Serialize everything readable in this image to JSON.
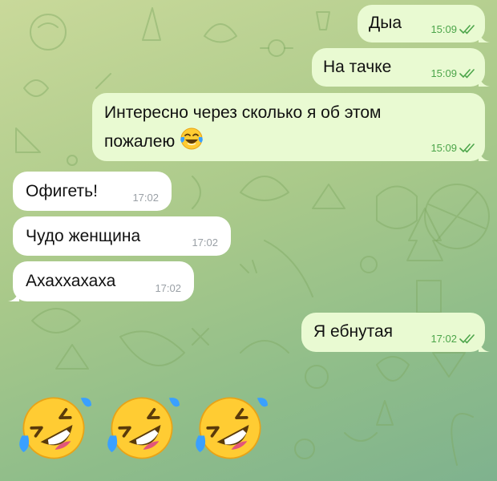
{
  "messages": [
    {
      "dir": "out",
      "text": "Дыа",
      "time": "15:09",
      "status": "read"
    },
    {
      "dir": "out",
      "text": "На тачке",
      "time": "15:09",
      "status": "read"
    },
    {
      "dir": "out",
      "text": "Интересно через сколько я об этом",
      "text2": "пожалею",
      "emoji": "face-with-tears-of-joy",
      "time": "15:09",
      "status": "read"
    },
    {
      "dir": "in",
      "text": "Офигеть!",
      "time": "17:02"
    },
    {
      "dir": "in",
      "text": "Чудо женщина",
      "time": "17:02"
    },
    {
      "dir": "in",
      "text": "Ахаххахаха",
      "time": "17:02"
    },
    {
      "dir": "out",
      "text": "Я ебнутая",
      "time": "17:02",
      "status": "read"
    }
  ],
  "big_emojis": [
    "rolling-on-the-floor-laughing",
    "rolling-on-the-floor-laughing",
    "rolling-on-the-floor-laughing"
  ],
  "colors": {
    "outgoing_bubble": "#e9fad2",
    "incoming_bubble": "#ffffff",
    "outgoing_meta": "#4ca54a",
    "incoming_meta": "#9aa0a6",
    "wallpaper": "#a9c98a"
  }
}
